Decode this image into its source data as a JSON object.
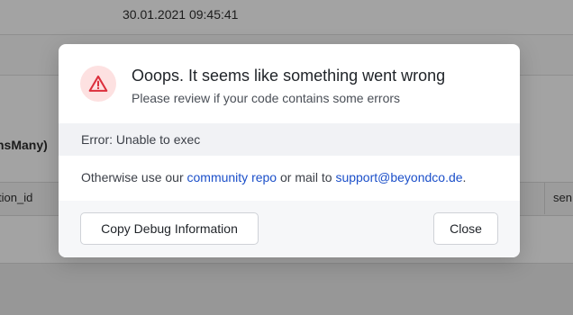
{
  "background": {
    "timestamp": "30.01.2021 09:45:41",
    "relation_label": "nsMany)",
    "column_left": "tion_id",
    "column_right": "sen"
  },
  "modal": {
    "icon": "warning-triangle-icon",
    "accent_color": "#dc2f3c",
    "title": "Ooops. It seems like something went wrong",
    "subtitle": "Please review if your code contains some errors",
    "error_message": "Error: Unable to exec",
    "help": {
      "prefix": "Otherwise use our ",
      "community_link": "community repo",
      "middle": " or mail to ",
      "email_link": "support@beyondco.de",
      "suffix": "."
    },
    "buttons": {
      "debug": "Copy Debug Information",
      "close": "Close"
    }
  }
}
